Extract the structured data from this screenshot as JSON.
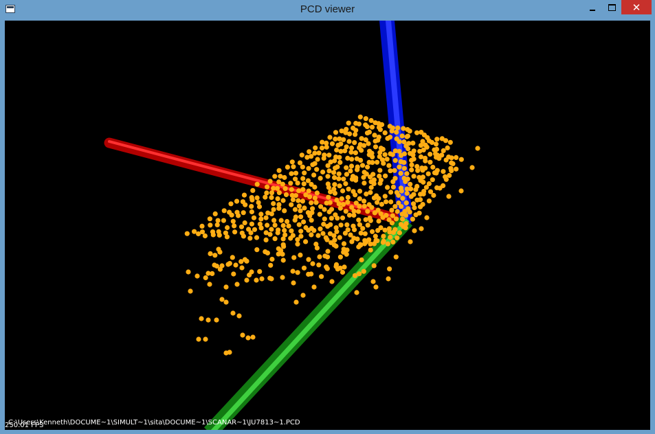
{
  "window": {
    "title": "PCD viewer",
    "buttons": [
      "minimize",
      "maximize",
      "close"
    ],
    "close_symbol": "✕"
  },
  "viewer": {
    "background": "#000000",
    "axes": [
      {
        "name": "x-axis",
        "color": "#c00000"
      },
      {
        "name": "y-axis",
        "color": "#1fa51f"
      },
      {
        "name": "z-axis",
        "color": "#0010cc"
      }
    ],
    "point_color": "#ffad14",
    "fps_text": "250.01 FPS",
    "file_path": "C:\\Users\\Kenneth\\DOCUME~1\\SIMULT~1\\sita\\DOCUME~1\\SCANAR~1\\JU7813~1.PCD"
  }
}
